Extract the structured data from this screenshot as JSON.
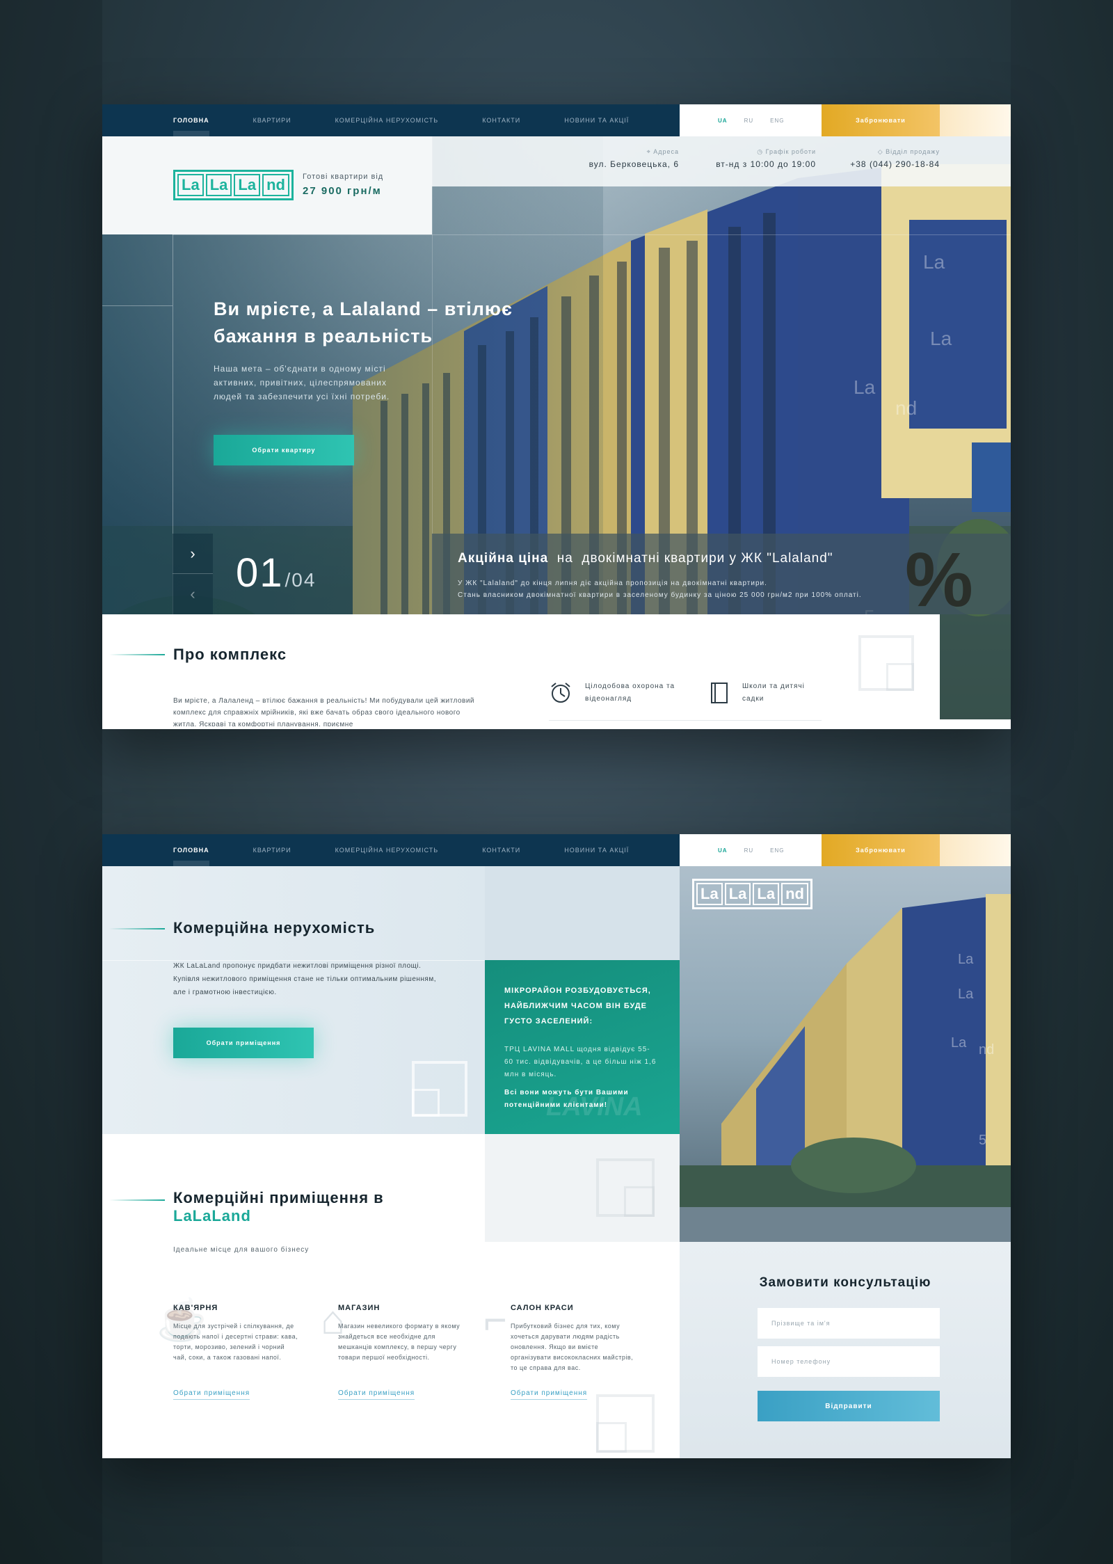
{
  "colors": {
    "nav_bg": "#0d3550",
    "accent_teal": "#1aa898",
    "accent_gold": "#e2a924",
    "accent_blue": "#3aa0c4"
  },
  "nav": {
    "items": [
      "Головна",
      "Квартири",
      "Комерційна нерухомість",
      "Контакти",
      "Новини та акції"
    ],
    "active_index": 0,
    "langs": [
      "UA",
      "RU",
      "ENG"
    ],
    "active_lang": "UA",
    "book_label": "Забронювати"
  },
  "logo": {
    "parts": [
      "La",
      "La",
      "La",
      "nd"
    ]
  },
  "header": {
    "price_label": "Готові квартири від",
    "price_value": "27 900 грн/м",
    "address_label": "Адреса",
    "address_value": "вул. Берковецька, 6",
    "hours_label": "Графік роботи",
    "hours_value": "вт-нд з 10:00 до 19:00",
    "sales_label": "Відділ продажу",
    "sales_value": "+38 (044) 290-18-84"
  },
  "hero": {
    "title": "Ви мрієте, а Lalaland – втілює бажання в реальність",
    "text": "Наша мета – об'єднати в одному місті активних, привітних, цілеспрямованих людей та забезпечити усі їхні потреби.",
    "button": "Обрати квартиру",
    "slide_current": "01",
    "slide_total": "/04",
    "next_icon": "chevron-right-icon",
    "prev_icon": "chevron-left-icon"
  },
  "promo": {
    "title_bold": "Акційна ціна",
    "title_rest": "  на  двокімнатні квартири у ЖК \"Lalaland\"",
    "line1": "У ЖК \"Lalaland\" до кінця липня діє акційна пропозиція на двокімнатні квартири.",
    "line2": "Стань власником двокімнатної квартири в заселеному будинку за ціною 25 000 грн/м2 при 100% оплаті.",
    "percent": "%"
  },
  "about": {
    "title": "Про комплекс",
    "text": "Ви мрієте, а Лалаленд – втілює бажання в реальність! Ми побудували цей житловий комплекс для справжніх мрійників, які вже бачать образ свого ідеального нового житла. Яскраві та комфортні планування, приємне",
    "feature1": "Цілодобова охорона та відеонагляд",
    "feature1_icon": "alarm-clock-icon",
    "feature2": "Школи та дитячі садки",
    "feature2_icon": "book-icon"
  },
  "commercial": {
    "title": "Комерційна нерухомість",
    "text": "ЖК LaLaLand пропонує придбати нежитлові приміщення різної площі. Купівля нежитлового приміщення стане не тільки оптимальним рішенням, але і грамотною інвестицією.",
    "button": "Обрати приміщення"
  },
  "green_box": {
    "heading": "МІКРОРАЙОН РОЗБУДОВУЄТЬСЯ, НАЙБЛИЖЧИМ ЧАСОМ ВІН БУДЕ ГУСТО ЗАСЕЛЕНИЙ:",
    "text1": "ТРЦ LAVINA MALL щодня відвідує 55-60 тис. відвідувачів, а це більш ніж 1,6 млн в місяць.",
    "text2": "Всі вони можуть бути Вашими потенційними клієнтами!",
    "watermark": "LAVINA"
  },
  "premises": {
    "title_line1": "Комерційні приміщення в",
    "title_line2": "LaLaLand",
    "subtitle": "Ідеальне місце для вашого бізнесу",
    "cards": [
      {
        "title": "КАВ'ЯРНЯ",
        "icon": "coffee-cup-icon",
        "text": "Місце для зустрічей і спілкування, де подають напої і десертні страви: кава, торти, морозиво, зелений і чорний чай, соки, а також газовані напої.",
        "link": "Обрати приміщення"
      },
      {
        "title": "МАГАЗИН",
        "icon": "shop-icon",
        "text": "Магазин невеликого формату в якому знайдеться все необхідне для мешканців комплексу, в першу чергу товари першої необхідності.",
        "link": "Обрати приміщення"
      },
      {
        "title": "САЛОН КРАСИ",
        "icon": "high-heel-icon",
        "text": "Прибутковий бізнес для тих, кому хочеться дарувати людям радість оновлення. Якщо ви вмієте організувати висококласних майстрів, то це справа для вас.",
        "link": "Обрати приміщення"
      }
    ]
  },
  "consult": {
    "title": "Замовити консультацію",
    "name_placeholder": "Прізвище та ім'я",
    "phone_placeholder": "Номер телефону",
    "submit": "Відправити"
  }
}
